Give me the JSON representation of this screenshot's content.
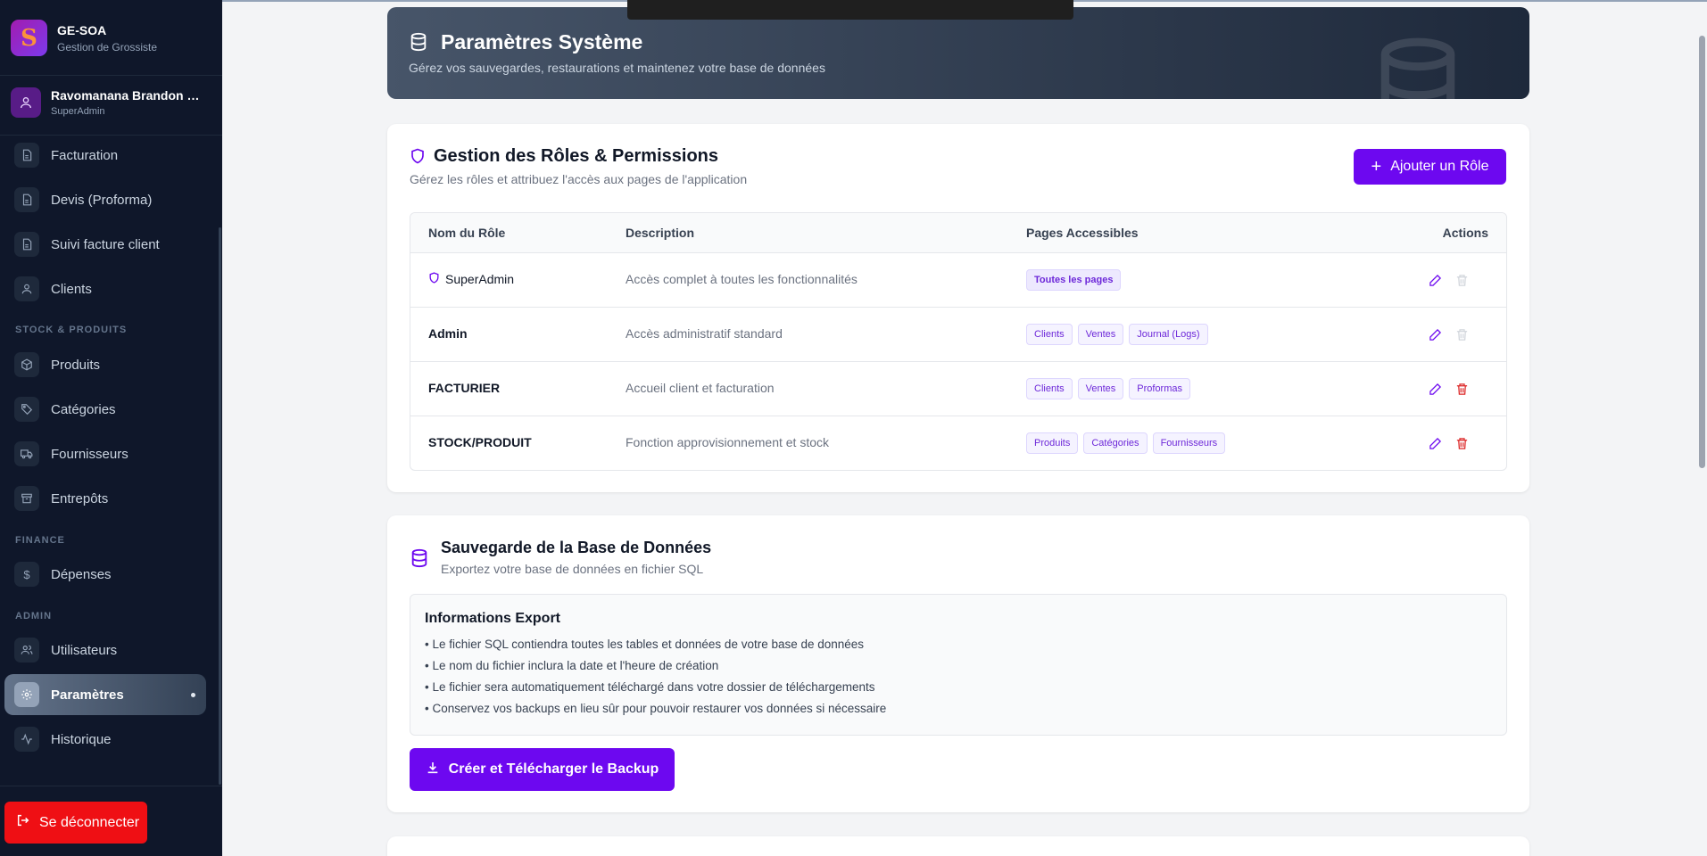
{
  "brand": {
    "title": "GE-SOA",
    "subtitle": "Gestion de Grossiste",
    "logo_letter": "S"
  },
  "user": {
    "name": "Ravomanana Brandon Fi...",
    "role": "SuperAdmin"
  },
  "nav": {
    "facturation": "Facturation",
    "devis": "Devis (Proforma)",
    "suivi": "Suivi facture client",
    "clients": "Clients",
    "section_stock": "STOCK & PRODUITS",
    "produits": "Produits",
    "categories": "Catégories",
    "fournisseurs": "Fournisseurs",
    "entrepots": "Entrepôts",
    "section_finance": "FINANCE",
    "depenses": "Dépenses",
    "section_admin": "ADMIN",
    "utilisateurs": "Utilisateurs",
    "parametres": "Paramètres",
    "historique": "Historique"
  },
  "logout_label": "Se déconnecter",
  "hero": {
    "title": "Paramètres Système",
    "subtitle": "Gérez vos sauvegardes, restaurations et maintenez votre base de données"
  },
  "roles": {
    "title": "Gestion des Rôles & Permissions",
    "subtitle": "Gérez les rôles et attribuez l'accès aux pages de l'application",
    "add_button": "Ajouter un Rôle",
    "columns": {
      "name": "Nom du Rôle",
      "description": "Description",
      "pages": "Pages Accessibles",
      "actions": "Actions"
    },
    "rows": [
      {
        "name": "SuperAdmin",
        "description": "Accès complet à toutes les fonctionnalités",
        "pages": [
          "Toutes les pages"
        ]
      },
      {
        "name": "Admin",
        "description": "Accès administratif standard",
        "pages": [
          "Clients",
          "Ventes",
          "Journal (Logs)"
        ]
      },
      {
        "name": "FACTURIER",
        "description": "Accueil client et facturation",
        "pages": [
          "Clients",
          "Ventes",
          "Proformas"
        ]
      },
      {
        "name": "STOCK/PRODUIT",
        "description": "Fonction approvisionnement et stock",
        "pages": [
          "Produits",
          "Catégories",
          "Fournisseurs"
        ]
      }
    ]
  },
  "backup": {
    "title": "Sauvegarde de la Base de Données",
    "subtitle": "Exportez votre base de données en fichier SQL",
    "info_title": "Informations Export",
    "info_lines": [
      "• Le fichier SQL contiendra toutes les tables et données de votre base de données",
      "• Le nom du fichier inclura la date et l'heure de création",
      "• Le fichier sera automatiquement téléchargé dans votre dossier de téléchargements",
      "• Conservez vos backups en lieu sûr pour pouvoir restaurer vos données si nécessaire"
    ],
    "button": "Créer et Télécharger le Backup"
  },
  "colors": {
    "accent": "#6d08f0",
    "danger": "#ef0f14",
    "sidebar": "#0f172a"
  }
}
